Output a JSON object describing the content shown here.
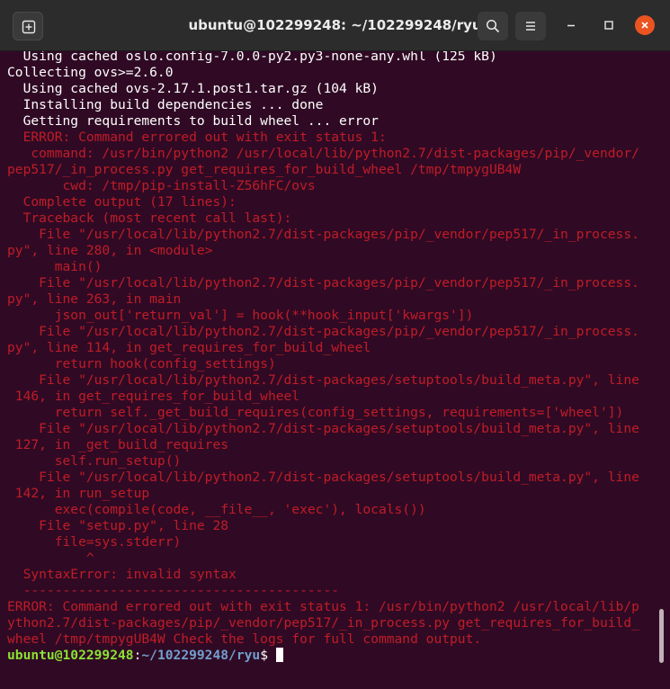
{
  "window": {
    "title": "ubuntu@102299248: ~/102299248/ryu"
  },
  "colors": {
    "terminal_bg": "#300a24",
    "error_text": "#c01c28",
    "prompt_user": "#8ae234",
    "prompt_path": "#729fcf",
    "close_button": "#e95420"
  },
  "terminal": {
    "lines": [
      {
        "text": "  Using cached oslo.config-7.0.0-py2.py3-none-any.whl (125 kB)",
        "style": "normal"
      },
      {
        "text": "Collecting ovs>=2.6.0",
        "style": "normal"
      },
      {
        "text": "  Using cached ovs-2.17.1.post1.tar.gz (104 kB)",
        "style": "normal"
      },
      {
        "text": "  Installing build dependencies ... done",
        "style": "normal"
      },
      {
        "text": "  Getting requirements to build wheel ... error",
        "style": "normal"
      },
      {
        "text": "  ERROR: Command errored out with exit status 1:",
        "style": "err"
      },
      {
        "text": "   command: /usr/bin/python2 /usr/local/lib/python2.7/dist-packages/pip/_vendor/",
        "style": "err"
      },
      {
        "text": "pep517/_in_process.py get_requires_for_build_wheel /tmp/tmpygUB4W",
        "style": "err"
      },
      {
        "text": "       cwd: /tmp/pip-install-Z56hFC/ovs",
        "style": "err"
      },
      {
        "text": "  Complete output (17 lines):",
        "style": "err"
      },
      {
        "text": "  Traceback (most recent call last):",
        "style": "err"
      },
      {
        "text": "    File \"/usr/local/lib/python2.7/dist-packages/pip/_vendor/pep517/_in_process.",
        "style": "err"
      },
      {
        "text": "py\", line 280, in <module>",
        "style": "err"
      },
      {
        "text": "      main()",
        "style": "err"
      },
      {
        "text": "    File \"/usr/local/lib/python2.7/dist-packages/pip/_vendor/pep517/_in_process.",
        "style": "err"
      },
      {
        "text": "py\", line 263, in main",
        "style": "err"
      },
      {
        "text": "      json_out['return_val'] = hook(**hook_input['kwargs'])",
        "style": "err"
      },
      {
        "text": "    File \"/usr/local/lib/python2.7/dist-packages/pip/_vendor/pep517/_in_process.",
        "style": "err"
      },
      {
        "text": "py\", line 114, in get_requires_for_build_wheel",
        "style": "err"
      },
      {
        "text": "      return hook(config_settings)",
        "style": "err"
      },
      {
        "text": "    File \"/usr/local/lib/python2.7/dist-packages/setuptools/build_meta.py\", line",
        "style": "err"
      },
      {
        "text": " 146, in get_requires_for_build_wheel",
        "style": "err"
      },
      {
        "text": "      return self._get_build_requires(config_settings, requirements=['wheel'])",
        "style": "err"
      },
      {
        "text": "    File \"/usr/local/lib/python2.7/dist-packages/setuptools/build_meta.py\", line",
        "style": "err"
      },
      {
        "text": " 127, in _get_build_requires",
        "style": "err"
      },
      {
        "text": "      self.run_setup()",
        "style": "err"
      },
      {
        "text": "    File \"/usr/local/lib/python2.7/dist-packages/setuptools/build_meta.py\", line",
        "style": "err"
      },
      {
        "text": " 142, in run_setup",
        "style": "err"
      },
      {
        "text": "      exec(compile(code, __file__, 'exec'), locals())",
        "style": "err"
      },
      {
        "text": "    File \"setup.py\", line 28",
        "style": "err"
      },
      {
        "text": "      file=sys.stderr)",
        "style": "err"
      },
      {
        "text": "          ^",
        "style": "err"
      },
      {
        "text": "  SyntaxError: invalid syntax",
        "style": "err"
      },
      {
        "text": "  ----------------------------------------",
        "style": "err"
      },
      {
        "text": "ERROR: Command errored out with exit status 1: /usr/bin/python2 /usr/local/lib/p",
        "style": "err"
      },
      {
        "text": "ython2.7/dist-packages/pip/_vendor/pep517/_in_process.py get_requires_for_build_",
        "style": "err"
      },
      {
        "text": "wheel /tmp/tmpygUB4W Check the logs for full command output.",
        "style": "err"
      }
    ],
    "prompt": {
      "user_host": "ubuntu@102299248",
      "separator": ":",
      "path": "~/102299248/ryu",
      "symbol": "$ "
    }
  }
}
